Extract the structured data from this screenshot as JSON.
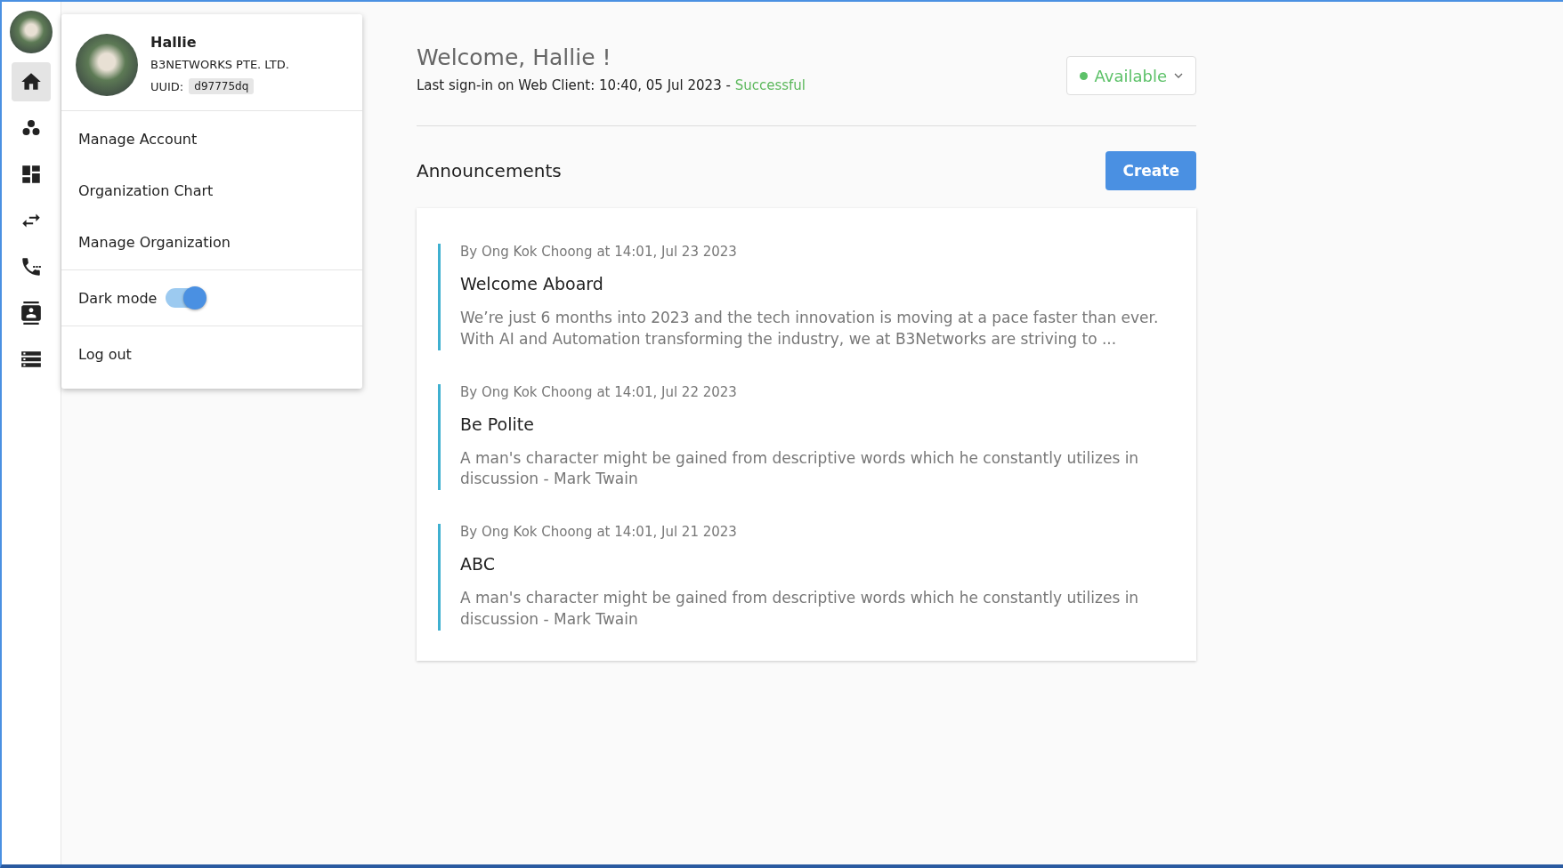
{
  "sidebar": {
    "items": [
      {
        "selected": true
      },
      {
        "selected": false
      },
      {
        "selected": false
      },
      {
        "selected": false
      },
      {
        "selected": false
      },
      {
        "selected": false
      },
      {
        "selected": false
      }
    ]
  },
  "user_menu": {
    "name": "Hallie",
    "company": "B3NETWORKS PTE. LTD.",
    "uuid_label": "UUID:",
    "uuid": "d97775dq",
    "sections": [
      {
        "items": [
          {
            "kind": "link",
            "label": "Manage Account"
          },
          {
            "kind": "link",
            "label": "Organization Chart"
          },
          {
            "kind": "link",
            "label": "Manage Organization"
          }
        ]
      },
      {
        "items": [
          {
            "kind": "toggle",
            "label": "Dark mode",
            "on": true
          }
        ]
      },
      {
        "items": [
          {
            "kind": "link",
            "label": "Log out"
          }
        ]
      }
    ]
  },
  "header": {
    "welcome": "Welcome, Hallie !",
    "last_signin": "Last sign-in on Web Client: 10:40, 05 Jul 2023 - ",
    "signin_result": "Successful",
    "status": {
      "label": "Available",
      "color": "#5cc168"
    }
  },
  "announcements": {
    "title": "Announcements",
    "create_button": "Create",
    "items": [
      {
        "meta": "By Ong Kok Choong at 14:01, Jul 23 2023",
        "title": "Welcome Aboard",
        "body": "We’re just 6 months into 2023 and the tech innovation is moving at a pace faster than ever. With AI and Automation transforming the industry, we at B3Networks are striving to ..."
      },
      {
        "meta": "By Ong Kok Choong at 14:01, Jul 22 2023",
        "title": "Be Polite",
        "body": "A man's character might be gained from descriptive words which he constantly utilizes in discussion - Mark Twain"
      },
      {
        "meta": "By Ong Kok Choong at 14:01, Jul 21 2023",
        "title": "ABC",
        "body": "A man's character might be gained from descriptive words which he constantly utilizes in discussion - Mark Twain"
      }
    ]
  }
}
